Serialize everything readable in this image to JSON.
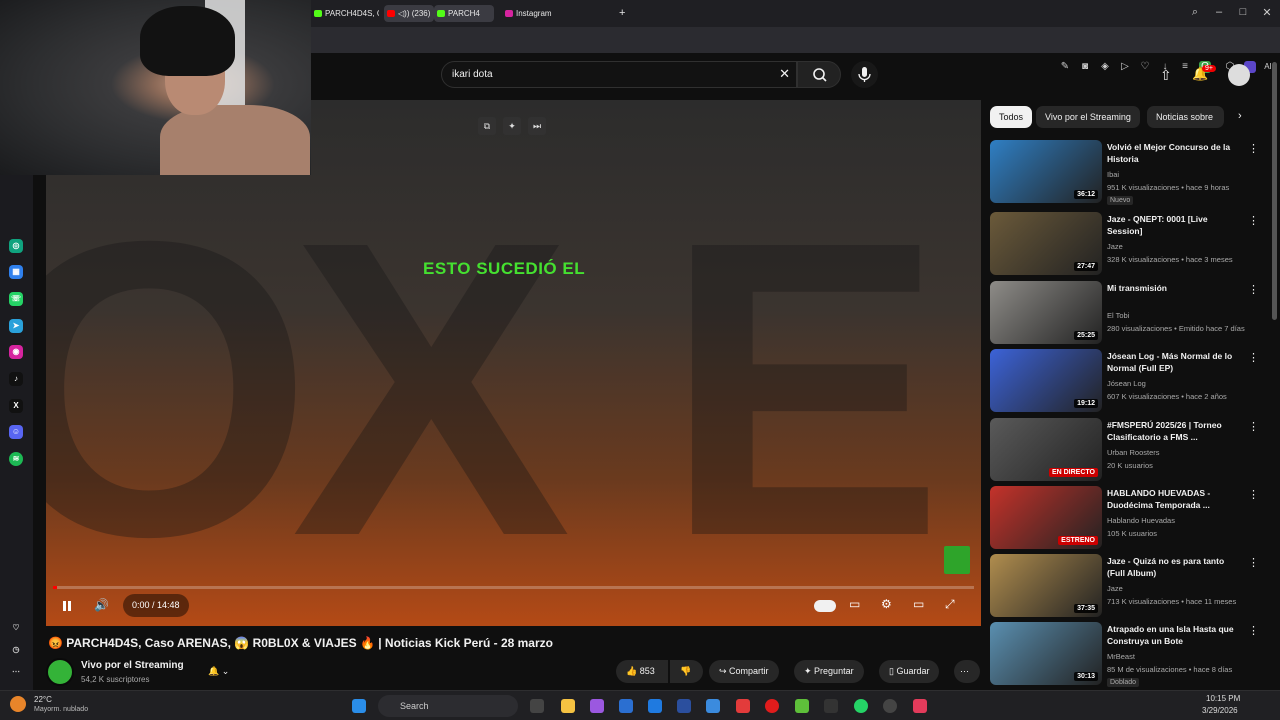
{
  "browser": {
    "tabs": [
      {
        "label": "PARCH4D4S, Ca",
        "icon": "kick-icon"
      },
      {
        "label": "◁)) (236)",
        "icon": "youtube-icon"
      },
      {
        "label": "PARCH4",
        "icon": "kick-icon"
      },
      {
        "label": "Instagram",
        "icon": "instagram-icon"
      }
    ],
    "new_tab": "+"
  },
  "search": {
    "value": "ikari dota"
  },
  "notifications": {
    "badge": "9+"
  },
  "video": {
    "caption": "ESTO SUCEDIÓ EL",
    "letters": [
      "O",
      "X",
      "E"
    ],
    "time": "0:00 / 14:48",
    "progress": 0.004
  },
  "meta": {
    "title": "😡 PARCH4D4S, Caso ARENAS, 😱 R0BL0X & VIAJES 🔥 | Noticias Kick Perú - 28 marzo",
    "channel": "Vivo por el Streaming",
    "subscribers": "54,2 K suscriptores",
    "likes": "853",
    "share": "Compartir",
    "ask": "Preguntar",
    "save": "Guardar"
  },
  "chips": [
    "Todos",
    "Vivo por el Streaming",
    "Noticias sobre"
  ],
  "recommendations": [
    {
      "title": "Volvió el Mejor Concurso de la Historia",
      "channel": "Ibai",
      "meta": "951 K visualizaciones • hace 9 horas",
      "badge": "Nuevo",
      "duration": "36:12",
      "color": "#2f7fc4"
    },
    {
      "title": "Jaze - QNEPT: 0001 [Live Session]",
      "channel": "Jaze",
      "meta": "328 K visualizaciones • hace 3 meses",
      "badge": "",
      "duration": "27:47",
      "color": "#6b5a3a"
    },
    {
      "title": "Mi transmisión",
      "channel": "El Tobi",
      "meta": "280 visualizaciones • Emitido hace 7 días",
      "badge": "",
      "duration": "25:25",
      "color": "#8e8c88"
    },
    {
      "title": "Jósean Log - Más Normal de lo Normal (Full EP)",
      "channel": "Jósean Log",
      "meta": "607 K visualizaciones • hace 2 años",
      "badge": "",
      "duration": "19:12",
      "color": "#3c63d8"
    },
    {
      "title": "#FMSPERÚ 2025/26 | Torneo Clasificatorio a FMS ...",
      "channel": "Urban Roosters",
      "meta": "20 K usuarios",
      "badge": "",
      "duration": "EN DIRECTO",
      "color": "#5a5a5a"
    },
    {
      "title": "HABLANDO HUEVADAS - Duodécima Temporada ...",
      "channel": "Hablando Huevadas",
      "meta": "105 K usuarios",
      "badge": "",
      "duration": "ESTRENO",
      "color": "#c4322a"
    },
    {
      "title": "Jaze - Quizá no es para tanto (Full Album)",
      "channel": "Jaze",
      "meta": "713 K visualizaciones • hace 11 meses",
      "badge": "",
      "duration": "37:35",
      "color": "#b08d4e"
    },
    {
      "title": "Atrapado en una Isla Hasta que Construya un Bote",
      "channel": "MrBeast",
      "meta": "85 M de visualizaciones • hace 8 días",
      "badge": "Doblado",
      "duration": "30:13",
      "color": "#5a8fb0"
    }
  ],
  "taskbar": {
    "weather_temp": "22°C",
    "weather_desc": "Mayorm. nublado",
    "search": "Search",
    "time": "10:15 PM",
    "date": "3/29/2026"
  }
}
